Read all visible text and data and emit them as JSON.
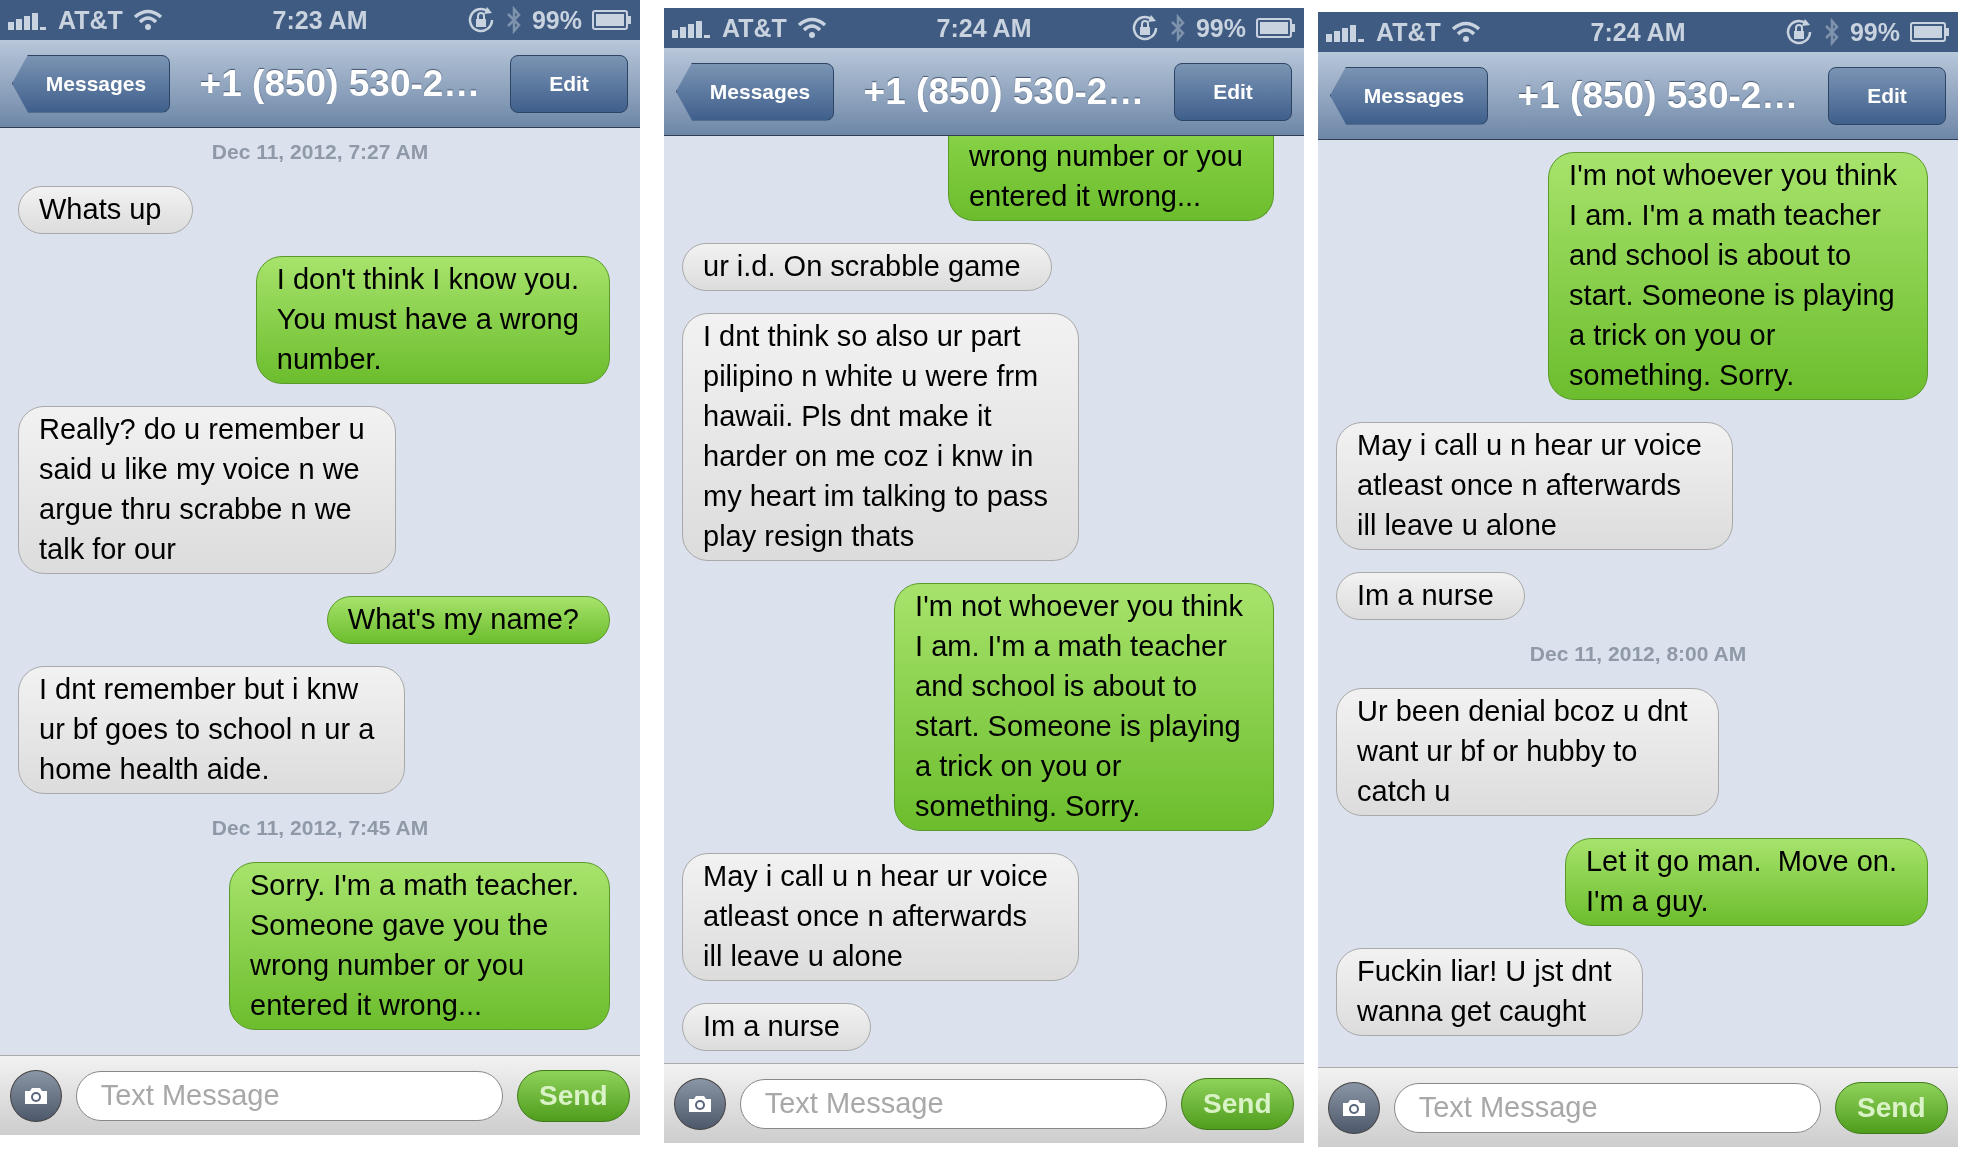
{
  "screens": [
    {
      "status_bar": {
        "carrier": "AT&T",
        "time": "7:23 AM",
        "battery": "99%"
      },
      "nav": {
        "back": "Messages",
        "title": "+1 (850) 530-2…",
        "edit": "Edit"
      },
      "messages": [
        {
          "kind": "timestamp",
          "text": "Dec 11, 2012, 7:27 AM"
        },
        {
          "kind": "incoming",
          "text": "Whats up"
        },
        {
          "kind": "outgoing",
          "text": "I don't think I know you.\nYou must have a wrong\nnumber."
        },
        {
          "kind": "incoming",
          "text": "Really? do u remember u\nsaid u like my voice n we\nargue thru scrabbe n we\ntalk for our"
        },
        {
          "kind": "outgoing",
          "text": "What's my name?"
        },
        {
          "kind": "incoming",
          "text": "I dnt remember but i knw\nur bf goes to school n ur a\nhome health aide."
        },
        {
          "kind": "timestamp",
          "text": "Dec 11, 2012, 7:45 AM"
        },
        {
          "kind": "outgoing",
          "text": "Sorry. I'm a math teacher.\nSomeone gave you the\nwrong number or you\nentered it wrong..."
        }
      ],
      "input": {
        "placeholder": "Text Message",
        "send": "Send"
      }
    },
    {
      "status_bar": {
        "carrier": "AT&T",
        "time": "7:24 AM",
        "battery": "99%"
      },
      "nav": {
        "back": "Messages",
        "title": "+1 (850) 530-2…",
        "edit": "Edit"
      },
      "messages": [
        {
          "kind": "outgoing",
          "text": "wrong number or you\nentered it wrong...",
          "clipped": true
        },
        {
          "kind": "incoming",
          "text": "ur i.d. On scrabble game"
        },
        {
          "kind": "incoming",
          "text": "I dnt think so also ur part\npilipino n white u were frm\nhawaii. Pls dnt make it\nharder on me coz i knw in\nmy heart im talking to pass\nplay resign thats"
        },
        {
          "kind": "outgoing",
          "text": "I'm not whoever you think\nI am. I'm a math teacher\nand school is about to\nstart. Someone is playing\na trick on you or\nsomething. Sorry."
        },
        {
          "kind": "incoming",
          "text": "May i call u n hear ur voice\natleast once n afterwards\nill leave u alone"
        },
        {
          "kind": "incoming",
          "text": "Im a nurse"
        }
      ],
      "input": {
        "placeholder": "Text Message",
        "send": "Send"
      }
    },
    {
      "status_bar": {
        "carrier": "AT&T",
        "time": "7:24 AM",
        "battery": "99%"
      },
      "nav": {
        "back": "Messages",
        "title": "+1 (850) 530-2…",
        "edit": "Edit"
      },
      "messages": [
        {
          "kind": "outgoing",
          "text": "I'm not whoever you think\nI am. I'm a math teacher\nand school is about to\nstart. Someone is playing\na trick on you or\nsomething. Sorry."
        },
        {
          "kind": "incoming",
          "text": "May i call u n hear ur voice\natleast once n afterwards\nill leave u alone"
        },
        {
          "kind": "incoming",
          "text": "Im a nurse"
        },
        {
          "kind": "timestamp",
          "text": "Dec 11, 2012, 8:00 AM"
        },
        {
          "kind": "incoming",
          "text": "Ur been denial bcoz u dnt\nwant ur bf or hubby to\ncatch u"
        },
        {
          "kind": "outgoing",
          "text": "Let it go man.  Move on.\nI'm a guy."
        },
        {
          "kind": "incoming",
          "text": "Fuckin liar! U jst dnt\nwanna get caught"
        }
      ],
      "input": {
        "placeholder": "Text Message",
        "send": "Send"
      }
    }
  ]
}
